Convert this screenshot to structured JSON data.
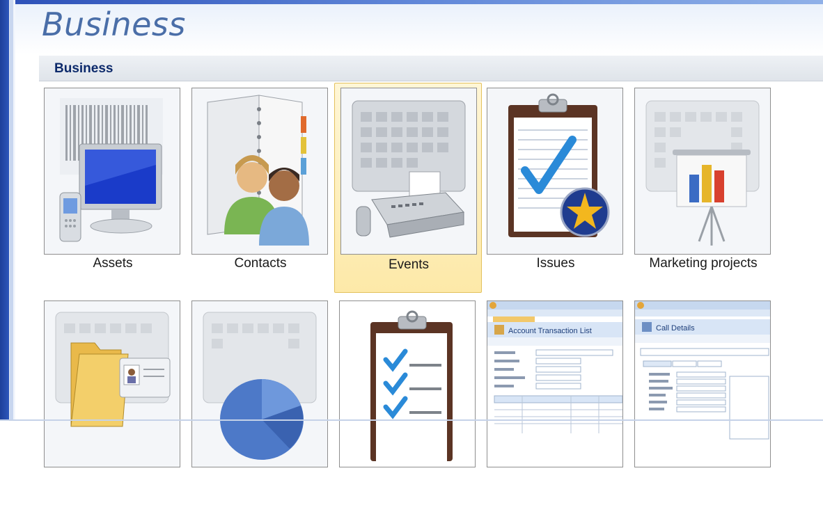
{
  "page_title": "Business",
  "section_title": "Business",
  "templates": [
    {
      "label": "Assets",
      "icon": "assets-icon"
    },
    {
      "label": "Contacts",
      "icon": "contacts-icon"
    },
    {
      "label": "Events",
      "icon": "events-icon",
      "selected": true
    },
    {
      "label": "Issues",
      "icon": "issues-icon"
    },
    {
      "label": "Marketing projects",
      "icon": "marketing-projects-icon"
    },
    {
      "label": "",
      "icon": "folder-contact-icon"
    },
    {
      "label": "",
      "icon": "pie-chart-icon"
    },
    {
      "label": "",
      "icon": "task-checklist-icon"
    },
    {
      "label": "",
      "icon": "account-transaction-screenshot"
    },
    {
      "label": "",
      "icon": "call-details-screenshot"
    }
  ],
  "screens": {
    "account": {
      "title": "Account Transaction List"
    },
    "call": {
      "title": "Call Details"
    }
  },
  "colors": {
    "accent": "#4a6ea8",
    "section_text": "#0d2a6b",
    "selected_bg": "#fde9a8"
  }
}
